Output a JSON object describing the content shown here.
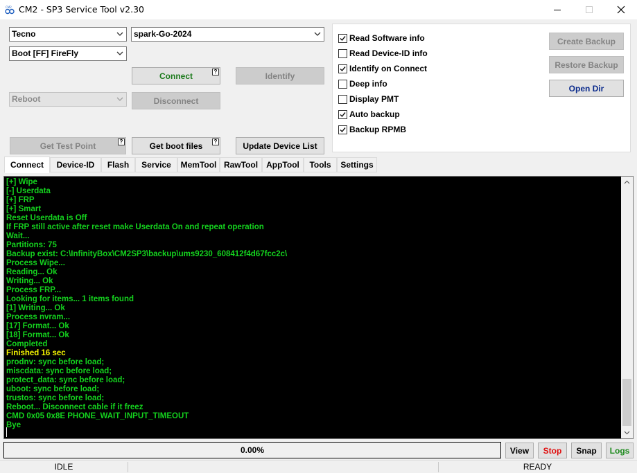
{
  "window": {
    "title": "CM2 - SP3 Service Tool v2.30",
    "icon": "cm2-logo-icon",
    "controls": {
      "minimize": "—",
      "maximize": "☐",
      "close": "✕"
    }
  },
  "top_left": {
    "brand_select": "Tecno",
    "model_select": "spark-Go-2024",
    "boot_select": "Boot [FF] FireFly",
    "reboot_select": "Reboot",
    "connect": "Connect",
    "identify": "Identify",
    "disconnect": "Disconnect",
    "get_test_point": "Get Test Point",
    "get_boot_files": "Get boot files",
    "update_device_list": "Update Device List",
    "help_mark": "?"
  },
  "options": [
    {
      "label": "Read Software info",
      "checked": true
    },
    {
      "label": "Read Device-ID info",
      "checked": false
    },
    {
      "label": "Identify on Connect",
      "checked": true
    },
    {
      "label": "Deep info",
      "checked": false
    },
    {
      "label": "Display PMT",
      "checked": false
    },
    {
      "label": "Auto backup",
      "checked": true
    },
    {
      "label": "Backup RPMB",
      "checked": true
    }
  ],
  "backup": {
    "create": "Create Backup",
    "restore": "Restore Backup",
    "open_dir": "Open Dir"
  },
  "tabs": [
    "Connect",
    "Device-ID",
    "Flash",
    "Service",
    "MemTool",
    "RawTool",
    "AppTool",
    "Tools",
    "Settings"
  ],
  "active_tab": "Connect",
  "log": [
    {
      "text": "[+] Wipe",
      "color": "green"
    },
    {
      "text": "[-] Userdata",
      "color": "green"
    },
    {
      "text": "[+] FRP",
      "color": "green"
    },
    {
      "text": "[+] Smart",
      "color": "green"
    },
    {
      "text": "Reset Userdata is Off",
      "color": "green"
    },
    {
      "text": "If FRP still active after reset make Userdata On and repeat operation",
      "color": "green"
    },
    {
      "text": "Wait...",
      "color": "green"
    },
    {
      "text": "Partitions: 75",
      "color": "green"
    },
    {
      "text": "Backup exist: C:\\InfinityBox\\CM2SP3\\backup\\ums9230_608412f4d67fcc2c\\",
      "color": "green"
    },
    {
      "text": "Process Wipe...",
      "color": "green"
    },
    {
      "text": "Reading... Ok",
      "color": "green"
    },
    {
      "text": "Writing... Ok",
      "color": "green"
    },
    {
      "text": "Process FRP...",
      "color": "green"
    },
    {
      "text": "Looking for items... 1 items found",
      "color": "green"
    },
    {
      "text": "[1] Writing... Ok",
      "color": "green"
    },
    {
      "text": "Process nvram...",
      "color": "green"
    },
    {
      "text": "[17] Format... Ok",
      "color": "green"
    },
    {
      "text": "[18] Format... Ok",
      "color": "green"
    },
    {
      "text": "Completed",
      "color": "green"
    },
    {
      "text": "Finished 16 sec",
      "color": "yellow"
    },
    {
      "text": "prodnv: sync before load;",
      "color": "green"
    },
    {
      "text": "miscdata: sync before load;",
      "color": "green"
    },
    {
      "text": "protect_data: sync before load;",
      "color": "green"
    },
    {
      "text": "uboot: sync before load;",
      "color": "green"
    },
    {
      "text": "trustos: sync before load;",
      "color": "green"
    },
    {
      "text": "Reboot... Disconnect cable if it freez",
      "color": "green"
    },
    {
      "text": "CMD 0x05 0x8E PHONE_WAIT_INPUT_TIMEOUT",
      "color": "green"
    },
    {
      "text": "Bye",
      "color": "green"
    }
  ],
  "progress": {
    "text": "0.00%",
    "value": 0
  },
  "bottom_buttons": {
    "view": "View",
    "stop": "Stop",
    "snap": "Snap",
    "logs": "Logs"
  },
  "status": {
    "left": "IDLE",
    "right": "READY"
  },
  "colors": {
    "log_green": "#14d21e",
    "log_yellow": "#f6f600",
    "connect_green": "#1c7a1c",
    "open_dir_blue": "#0a2a8c",
    "stop_red": "#e01010",
    "logs_green": "#1c8a1c"
  }
}
